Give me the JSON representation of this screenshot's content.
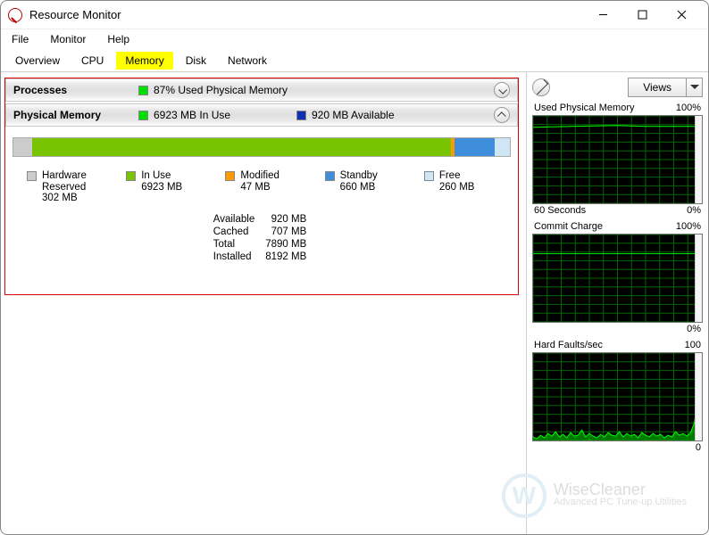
{
  "window": {
    "title": "Resource Monitor"
  },
  "menubar": {
    "file": "File",
    "monitor": "Monitor",
    "help": "Help"
  },
  "tabs": {
    "overview": "Overview",
    "cpu": "CPU",
    "memory": "Memory",
    "disk": "Disk",
    "network": "Network"
  },
  "processes": {
    "title": "Processes",
    "summary": "87% Used Physical Memory"
  },
  "physmem": {
    "title": "Physical Memory",
    "inuse_label": "6923 MB In Use",
    "avail_label": "920 MB Available"
  },
  "legend": {
    "hardware": {
      "label": "Hardware",
      "label2": "Reserved",
      "value": "302 MB",
      "color": "#cccccc"
    },
    "inuse": {
      "label": "In Use",
      "value": "6923 MB",
      "color": "#66cc00"
    },
    "modified": {
      "label": "Modified",
      "value": "47 MB",
      "color": "#ff9900"
    },
    "standby": {
      "label": "Standby",
      "value": "660 MB",
      "color": "#3388dd"
    },
    "free": {
      "label": "Free",
      "value": "260 MB",
      "color": "#d0e8f8"
    }
  },
  "stats": {
    "available": {
      "label": "Available",
      "value": "920 MB"
    },
    "cached": {
      "label": "Cached",
      "value": "707 MB"
    },
    "total": {
      "label": "Total",
      "value": "7890 MB"
    },
    "installed": {
      "label": "Installed",
      "value": "8192 MB"
    }
  },
  "right": {
    "views": "Views",
    "charts": [
      {
        "title": "Used Physical Memory",
        "max": "100%",
        "x0": "60 Seconds",
        "x1": "0%"
      },
      {
        "title": "Commit Charge",
        "max": "100%",
        "x0": "",
        "x1": "0%"
      },
      {
        "title": "Hard Faults/sec",
        "max": "100",
        "x0": "",
        "x1": "0"
      }
    ]
  },
  "chart_data": [
    {
      "type": "line",
      "title": "Used Physical Memory",
      "y_percent_constant": 88,
      "ylim": [
        0,
        100
      ],
      "x_seconds": [
        60,
        0
      ]
    },
    {
      "type": "line",
      "title": "Commit Charge",
      "y_percent_constant": 78,
      "ylim": [
        0,
        100
      ],
      "x_seconds": [
        60,
        0
      ]
    },
    {
      "type": "area",
      "title": "Hard Faults/sec",
      "x": [
        0,
        4,
        8,
        12,
        16,
        20,
        24,
        28,
        32,
        36,
        40,
        44,
        48,
        52,
        56,
        60,
        64,
        68,
        72,
        76,
        80,
        84,
        88,
        92,
        96,
        100,
        104,
        108,
        112,
        116,
        120,
        124,
        128,
        132,
        136,
        140,
        144,
        148,
        152,
        156,
        160,
        164,
        168,
        172,
        176,
        180
      ],
      "values": [
        4,
        2,
        6,
        3,
        8,
        5,
        10,
        4,
        7,
        3,
        9,
        5,
        6,
        12,
        4,
        8,
        5,
        3,
        7,
        4,
        9,
        6,
        5,
        10,
        4,
        8,
        5,
        7,
        3,
        9,
        6,
        4,
        8,
        5,
        7,
        3,
        6,
        4,
        10,
        6,
        8,
        5,
        9,
        20,
        50,
        8
      ],
      "ylim": [
        0,
        100
      ]
    }
  ],
  "watermark": {
    "brand": "WiseCleaner",
    "slogan": "Advanced PC Tune-up Utilities"
  }
}
